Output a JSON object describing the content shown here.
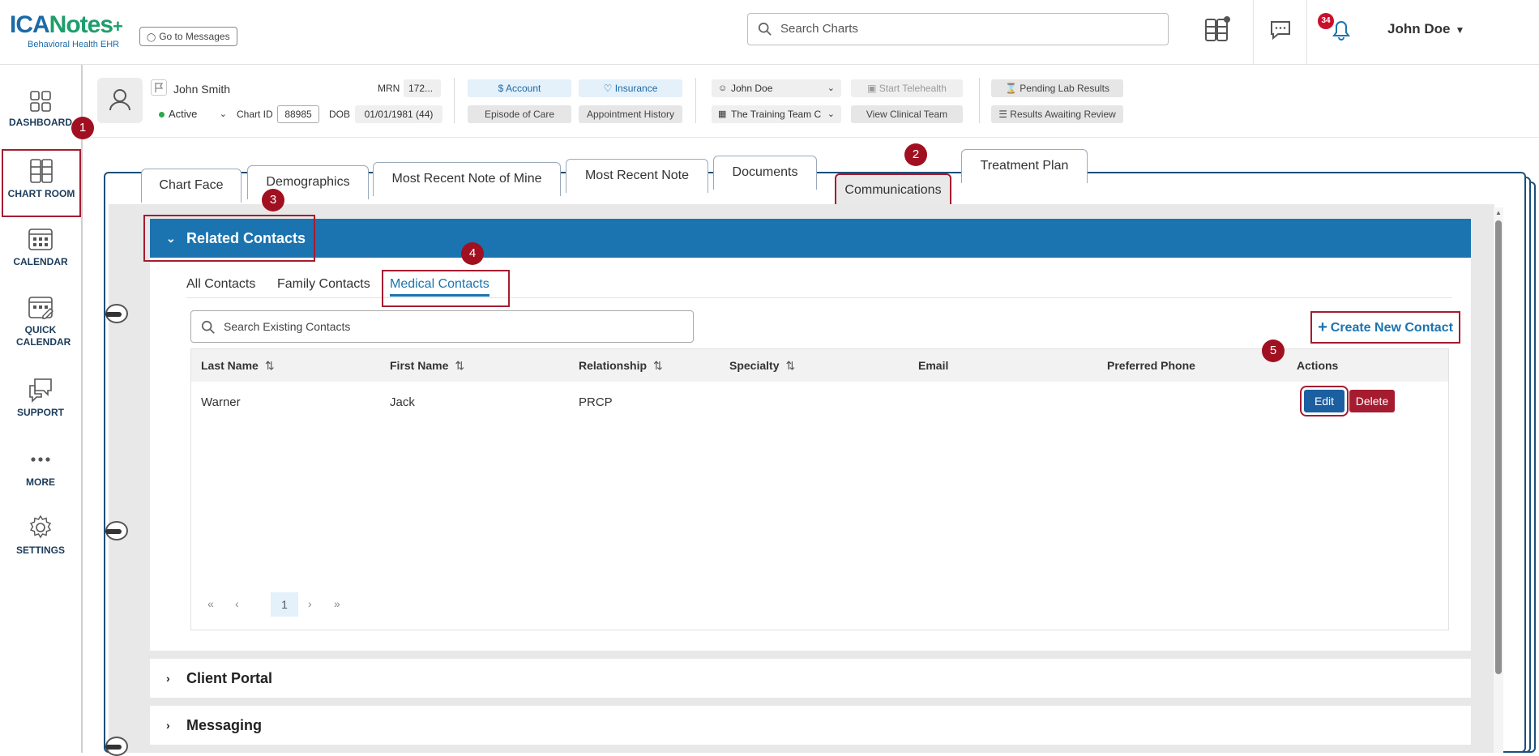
{
  "app": {
    "brand": "ICANotes",
    "brand_sub": "Behavioral Health EHR",
    "go_to_messages": "Go to Messages",
    "search_placeholder": "Search Charts",
    "notification_count": "34",
    "user_name": "John Doe"
  },
  "sidebar": {
    "items": [
      {
        "label": "DASHBOARD",
        "icon": "dashboard-icon"
      },
      {
        "label": "CHART ROOM",
        "icon": "chart-room-icon"
      },
      {
        "label": "CALENDAR",
        "icon": "calendar-icon"
      },
      {
        "label": "QUICK CALENDAR",
        "icon": "quick-calendar-icon"
      },
      {
        "label": "SUPPORT",
        "icon": "support-icon"
      },
      {
        "label": "MORE",
        "icon": "more-icon"
      },
      {
        "label": "SETTINGS",
        "icon": "gear-icon"
      }
    ]
  },
  "patient": {
    "name": "John Smith",
    "mrn_label": "MRN",
    "mrn": "172...",
    "status": "Active",
    "chart_id_label": "Chart ID",
    "chart_id": "88985",
    "dob_label": "DOB",
    "dob": "01/01/1981 (44)",
    "account": "Account",
    "insurance": "Insurance",
    "episode_of_care": "Episode of Care",
    "appointment_history": "Appointment History",
    "provider": "John Doe",
    "team": "The Training Team C",
    "start_telehealth": "Start Telehealth",
    "view_clinical_team": "View Clinical Team",
    "pending_lab_results": "Pending Lab Results",
    "results_awaiting_review": "Results Awaiting Review"
  },
  "tabs": [
    "Chart Face",
    "Demographics",
    "Most Recent Note of Mine",
    "Most Recent Note",
    "Documents",
    "Communications",
    "Treatment Plan"
  ],
  "related_contacts": {
    "title": "Related Contacts",
    "subtabs": [
      "All Contacts",
      "Family Contacts",
      "Medical Contacts"
    ],
    "search_placeholder": "Search Existing Contacts",
    "create_label": "Create New Contact",
    "columns": [
      "Last Name",
      "First Name",
      "Relationship",
      "Specialty",
      "Email",
      "Preferred Phone",
      "Actions"
    ],
    "rows": [
      {
        "last": "Warner",
        "first": "Jack",
        "relationship": "PRCP",
        "specialty": "",
        "email": "",
        "phone": ""
      }
    ],
    "edit_label": "Edit",
    "delete_label": "Delete",
    "current_page": "1"
  },
  "sections": {
    "client_portal": "Client Portal",
    "messaging": "Messaging"
  },
  "callouts": [
    "1",
    "2",
    "3",
    "4",
    "5"
  ],
  "colors": {
    "primary_blue": "#1b74b0",
    "highlight_red": "#a51c30",
    "callout_red": "#a01020"
  }
}
